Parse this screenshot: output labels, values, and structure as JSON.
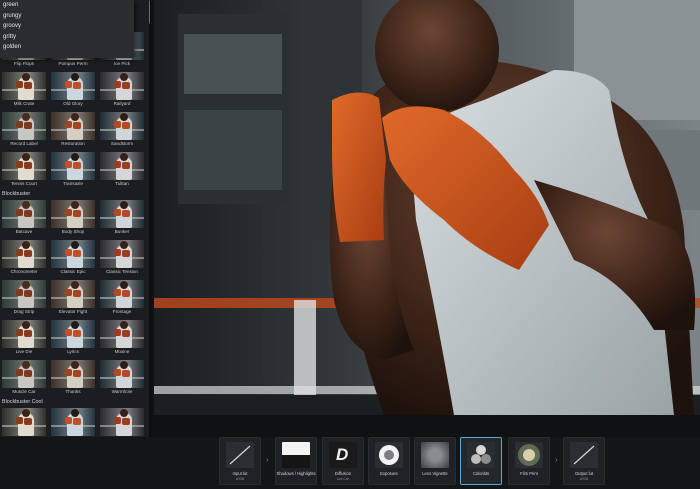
{
  "dropdown": {
    "options": [
      "green",
      "grungy",
      "groovy",
      "gritty",
      "golden"
    ]
  },
  "browser": {
    "top_rows": [
      [
        "Flip Flops",
        "Pompus Perm",
        "Ice Pick"
      ],
      [
        "Milk Crate",
        "Old Glory",
        "Railyard"
      ],
      [
        "Record Label",
        "Restoration",
        "Sandstorm"
      ],
      [
        "Tennis Court",
        "Transaxle",
        "Tulitan"
      ]
    ],
    "sections": [
      {
        "title": "Blockbuster",
        "rows": [
          [
            "Batcave",
            "Body Shop",
            "Bunker"
          ],
          [
            "Chronometer",
            "Classic Epic",
            "Classic Tension"
          ],
          [
            "Drag Strip",
            "Elevator Fight",
            "Frontage"
          ],
          [
            "Live Die",
            "Lyrics",
            "Moxine"
          ],
          [
            "Muscle Car",
            "Thanks",
            "Warmhole"
          ]
        ]
      },
      {
        "title": "Blockbuster Cool",
        "rows": [
          [
            "",
            "",
            ""
          ]
        ]
      }
    ]
  },
  "nodes": [
    {
      "label": "Input lut",
      "sub": "sRGB",
      "icon": "input-curve-icon"
    },
    {
      "label": "Shadows / Highlights",
      "sub": "",
      "icon": "shadows-highlights-icon"
    },
    {
      "label": "Diffusion",
      "sub": "Low Con",
      "icon": "diffusion-icon"
    },
    {
      "label": "Exposure",
      "sub": "",
      "icon": "exposure-icon"
    },
    {
      "label": "Lens Vignette",
      "sub": "",
      "icon": "vignette-icon"
    },
    {
      "label": "Colorists",
      "sub": "",
      "icon": "colorists-icon"
    },
    {
      "label": "Film Print",
      "sub": "",
      "icon": "film-print-icon"
    },
    {
      "label": "Output lut",
      "sub": "sRGB",
      "icon": "output-curve-icon"
    }
  ],
  "colors": {
    "accent": "#5aa7d6",
    "panel": "#1b1d20",
    "wrap": "#d2591f"
  }
}
